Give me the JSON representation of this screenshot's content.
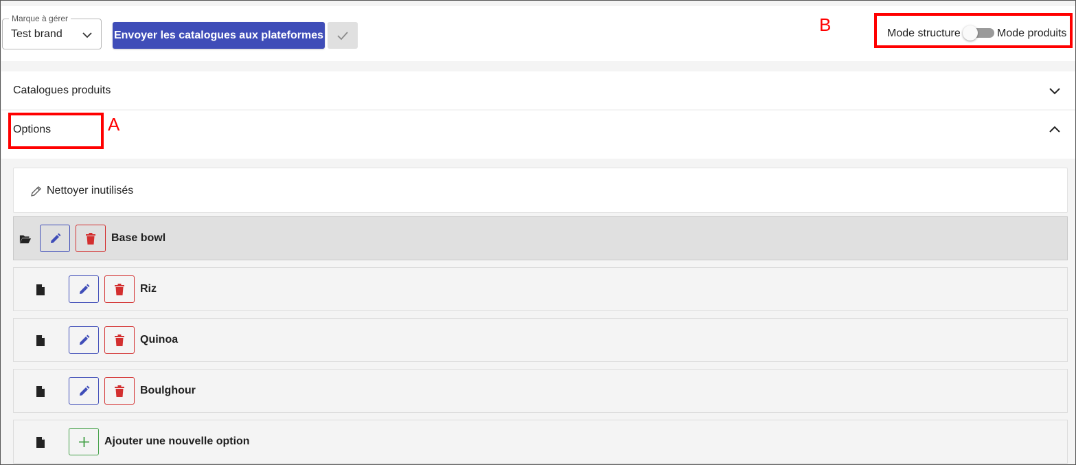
{
  "header": {
    "brand_select": {
      "legend": "Marque à gérer",
      "value": "Test brand"
    },
    "send_button": "Envoyer les catalogues aux plateformes",
    "mode_toggle": {
      "left_label": "Mode structure",
      "right_label": "Mode produits",
      "state": "off"
    }
  },
  "annotations": {
    "a": "A",
    "b": "B",
    "color": "#ff0000"
  },
  "panels": {
    "catalogues": {
      "title": "Catalogues produits",
      "expanded": false
    },
    "options": {
      "title": "Options",
      "expanded": true
    }
  },
  "options_panel": {
    "cleanup_label": "Nettoyer inutilisés",
    "group": {
      "label": "Base bowl"
    },
    "items": [
      {
        "label": "Riz"
      },
      {
        "label": "Quinoa"
      },
      {
        "label": "Boulghour"
      }
    ],
    "add_label": "Ajouter une nouvelle option"
  },
  "colors": {
    "primary": "#3f4db8",
    "danger": "#d32f2f",
    "success": "#43a047",
    "group_row_bg": "#e0e0e0",
    "item_row_bg": "#f4f4f4"
  }
}
